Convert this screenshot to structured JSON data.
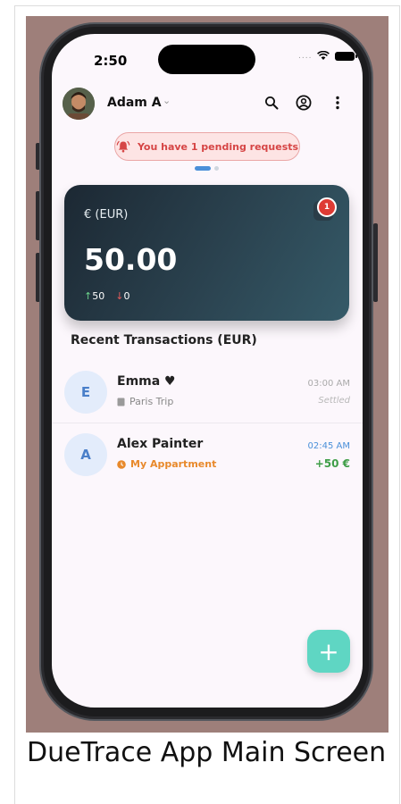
{
  "status_bar": {
    "time": "2:50",
    "signal": "....",
    "wifi_icon": "wifi-icon",
    "battery_icon": "battery-icon"
  },
  "header": {
    "user_name": "Adam A",
    "chevron": "⌄",
    "icons": [
      "search-icon",
      "account-circle-icon",
      "more-vert-icon"
    ]
  },
  "pending_banner": {
    "text": "You have 1 pending requests",
    "icon": "bell-alert-icon"
  },
  "card": {
    "currency": "€ (EUR)",
    "balance": "50.00",
    "incoming": "50",
    "outgoing": "0",
    "notification_count": "1"
  },
  "recent": {
    "title": "Recent Transactions (EUR)",
    "items": [
      {
        "initial": "E",
        "name": "Emma ♥",
        "group": "Paris Trip",
        "time": "03:00 AM",
        "status": "Settled",
        "amount": ""
      },
      {
        "initial": "A",
        "name": "Alex Painter",
        "group": "My Appartment",
        "time": "02:45 AM",
        "status": "",
        "amount": "+50 €"
      }
    ]
  },
  "fab": {
    "label": "+"
  },
  "caption": "DueTrace App Main Screen",
  "colors": {
    "accent": "#5fd6c3",
    "danger": "#de3b34",
    "card_dark": "#1c2833",
    "group_orange": "#e8892b",
    "positive": "#3f9e48"
  }
}
